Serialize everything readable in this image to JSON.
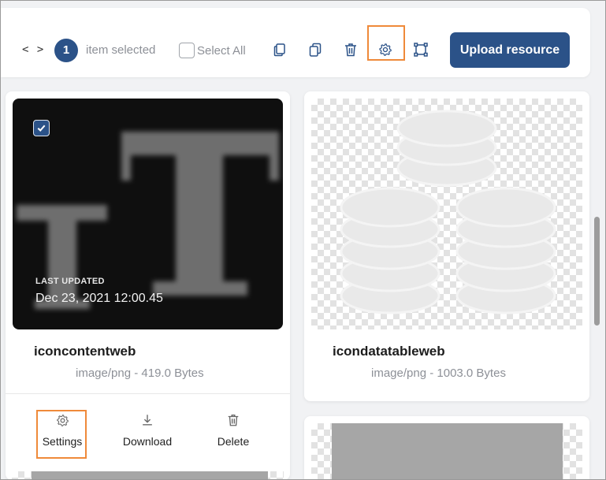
{
  "toolbar": {
    "code_toggle": "< >",
    "selected_count": "1",
    "selected_label": "item selected",
    "select_all_label": "Select All",
    "upload_label": "Upload resource"
  },
  "cards": [
    {
      "name": "iconcontentweb",
      "meta": "image/png - 419.0 Bytes",
      "last_updated_label": "LAST UPDATED",
      "last_updated_value": "Dec 23, 2021 12:00.45",
      "selected": true,
      "actions": {
        "settings": "Settings",
        "download": "Download",
        "delete": "Delete"
      }
    },
    {
      "name": "icondatatableweb",
      "meta": "image/png - 1003.0 Bytes"
    }
  ],
  "colors": {
    "accent": "#2b5288",
    "highlight": "#ef8a3a",
    "muted_text": "#8d9097"
  },
  "icons": {
    "toolbar": [
      "code-icon",
      "copy-icon",
      "duplicate-icon",
      "trash-icon",
      "gear-icon",
      "crop-icon"
    ],
    "card_actions": [
      "gear-icon",
      "download-icon",
      "trash-icon"
    ]
  }
}
